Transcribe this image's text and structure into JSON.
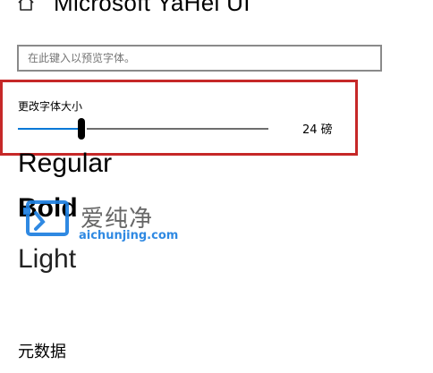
{
  "header": {
    "title": "Microsoft YaHei UI",
    "home_icon": "home-icon"
  },
  "preview": {
    "placeholder": "在此键入以预览字体。",
    "value": ""
  },
  "font_size": {
    "label": "更改字体大小",
    "value_text": "24 磅",
    "level_fraction": 0.255,
    "accent_color": "#0078d7"
  },
  "samples": {
    "regular": "Regular",
    "bold": "Bold",
    "light": "Light"
  },
  "metadata": {
    "heading": "元数据"
  },
  "annotation": {
    "highlight_color": "#c62828"
  },
  "watermark": {
    "text_cn": "爱纯净",
    "url": "aichunjing.com",
    "logo_icon": "watermark-logo-icon"
  }
}
